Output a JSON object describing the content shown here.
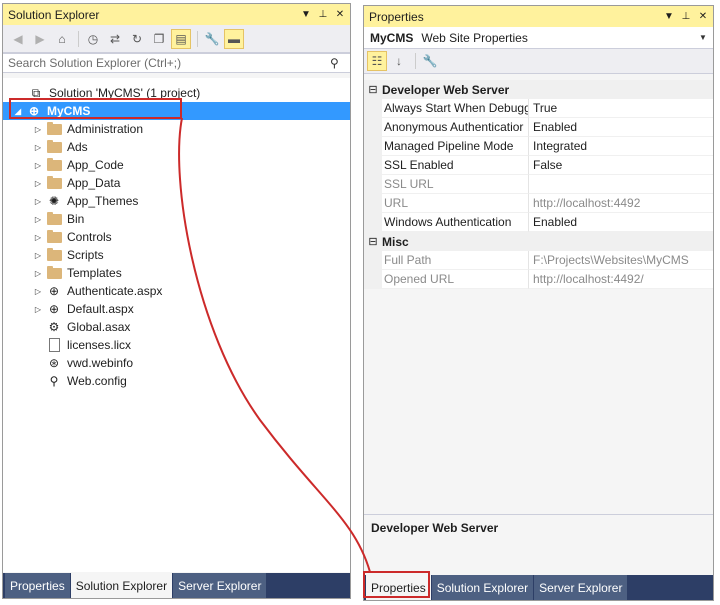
{
  "solution_explorer": {
    "title": "Solution Explorer",
    "search_placeholder": "Search Solution Explorer (Ctrl+;)",
    "tree": [
      {
        "label": "Solution 'MyCMS' (1 project)",
        "icon": "solution-icon",
        "expand": ""
      },
      {
        "label": "MyCMS",
        "icon": "web-project-icon",
        "expand": "◢",
        "selected": true
      },
      {
        "label": "Administration",
        "icon": "folder-icon",
        "expand": "▷"
      },
      {
        "label": "Ads",
        "icon": "folder-icon",
        "expand": "▷"
      },
      {
        "label": "App_Code",
        "icon": "folder-icon",
        "expand": "▷"
      },
      {
        "label": "App_Data",
        "icon": "folder-icon",
        "expand": "▷"
      },
      {
        "label": "App_Themes",
        "icon": "themes-icon",
        "expand": "▷"
      },
      {
        "label": "Bin",
        "icon": "folder-icon",
        "expand": "▷"
      },
      {
        "label": "Controls",
        "icon": "folder-icon",
        "expand": "▷"
      },
      {
        "label": "Scripts",
        "icon": "folder-icon",
        "expand": "▷"
      },
      {
        "label": "Templates",
        "icon": "folder-icon",
        "expand": "▷"
      },
      {
        "label": "Authenticate.aspx",
        "icon": "aspx-file-icon",
        "expand": "▷"
      },
      {
        "label": "Default.aspx",
        "icon": "aspx-file-icon",
        "expand": "▷"
      },
      {
        "label": "Global.asax",
        "icon": "asax-file-icon",
        "expand": ""
      },
      {
        "label": "licenses.licx",
        "icon": "file-icon",
        "expand": ""
      },
      {
        "label": "vwd.webinfo",
        "icon": "webinfo-file-icon",
        "expand": ""
      },
      {
        "label": "Web.config",
        "icon": "config-file-icon",
        "expand": ""
      }
    ],
    "tabs": [
      "Properties",
      "Solution Explorer",
      "Server Explorer"
    ],
    "active_tab": "Solution Explorer"
  },
  "properties": {
    "title": "Properties",
    "object_name": "MyCMS",
    "object_type": "Web Site Properties",
    "categories": [
      {
        "name": "Developer Web Server",
        "rows": [
          {
            "name": "Always Start When Debugg",
            "value": "True",
            "readonly": false
          },
          {
            "name": "Anonymous Authenticatior",
            "value": "Enabled",
            "readonly": false
          },
          {
            "name": "Managed Pipeline Mode",
            "value": "Integrated",
            "readonly": false
          },
          {
            "name": "SSL Enabled",
            "value": "False",
            "readonly": false
          },
          {
            "name": "SSL URL",
            "value": "",
            "readonly": true
          },
          {
            "name": "URL",
            "value": "http://localhost:4492",
            "readonly": true
          },
          {
            "name": "Windows Authentication",
            "value": "Enabled",
            "readonly": false
          }
        ]
      },
      {
        "name": "Misc",
        "rows": [
          {
            "name": "Full Path",
            "value": "F:\\Projects\\Websites\\MyCMS",
            "readonly": true
          },
          {
            "name": "Opened URL",
            "value": "http://localhost:4492/",
            "readonly": true
          }
        ]
      }
    ],
    "description_title": "Developer Web Server",
    "tabs": [
      "Properties",
      "Solution Explorer",
      "Server Explorer"
    ],
    "active_tab": "Properties"
  },
  "colors": {
    "title_active": "#fff29d",
    "selection": "#3399ff",
    "highlight": "#cc2a2a",
    "tab_bar": "#2d3e66"
  }
}
